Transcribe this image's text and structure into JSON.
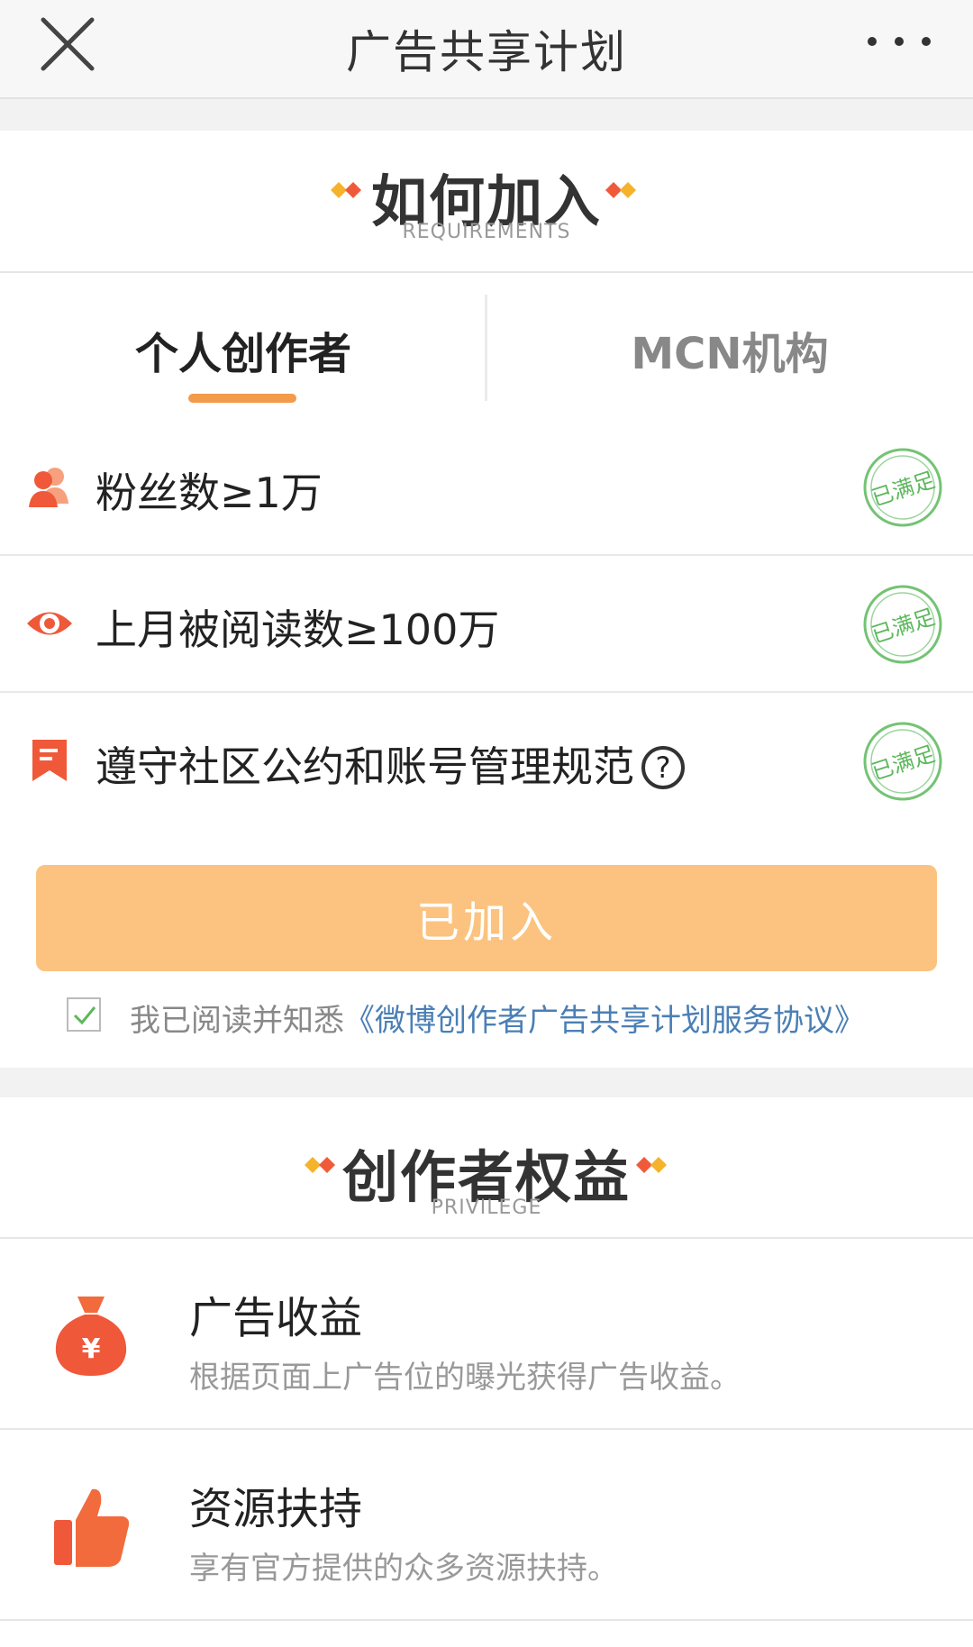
{
  "topbar": {
    "title": "广告共享计划"
  },
  "requirements": {
    "title": "如何加入",
    "subtitle": "REQUIREMENTS",
    "tabs": [
      {
        "label": "个人创作者",
        "active": true
      },
      {
        "label": "MCN机构",
        "active": false
      }
    ],
    "items": [
      {
        "icon": "fans-icon",
        "text": "粉丝数≥1万",
        "status": "已满足"
      },
      {
        "icon": "eye-icon",
        "text": "上月被阅读数≥100万",
        "status": "已满足"
      },
      {
        "icon": "bookmark-icon",
        "text": "遵守社区公约和账号管理规范",
        "help": "?",
        "status": "已满足"
      }
    ],
    "join_button": "已加入",
    "agreement": {
      "prefix": "我已阅读并知悉",
      "link": "《微博创作者广告共享计划服务协议》",
      "checked": true
    }
  },
  "privilege": {
    "title": "创作者权益",
    "subtitle": "PRIVILEGE",
    "items": [
      {
        "icon": "money-bag-icon",
        "icon_glyph": "¥",
        "title": "广告收益",
        "desc": "根据页面上广告位的曝光获得广告收益。"
      },
      {
        "icon": "thumbs-up-icon",
        "title": "资源扶持",
        "desc": "享有官方提供的众多资源扶持。"
      }
    ]
  },
  "colors": {
    "accent_orange": "#f39a4b",
    "button_bg": "#fbc37f",
    "stamp_green": "#5cb85c",
    "link_blue": "#4a7fb5",
    "icon_red": "#f0583a"
  }
}
